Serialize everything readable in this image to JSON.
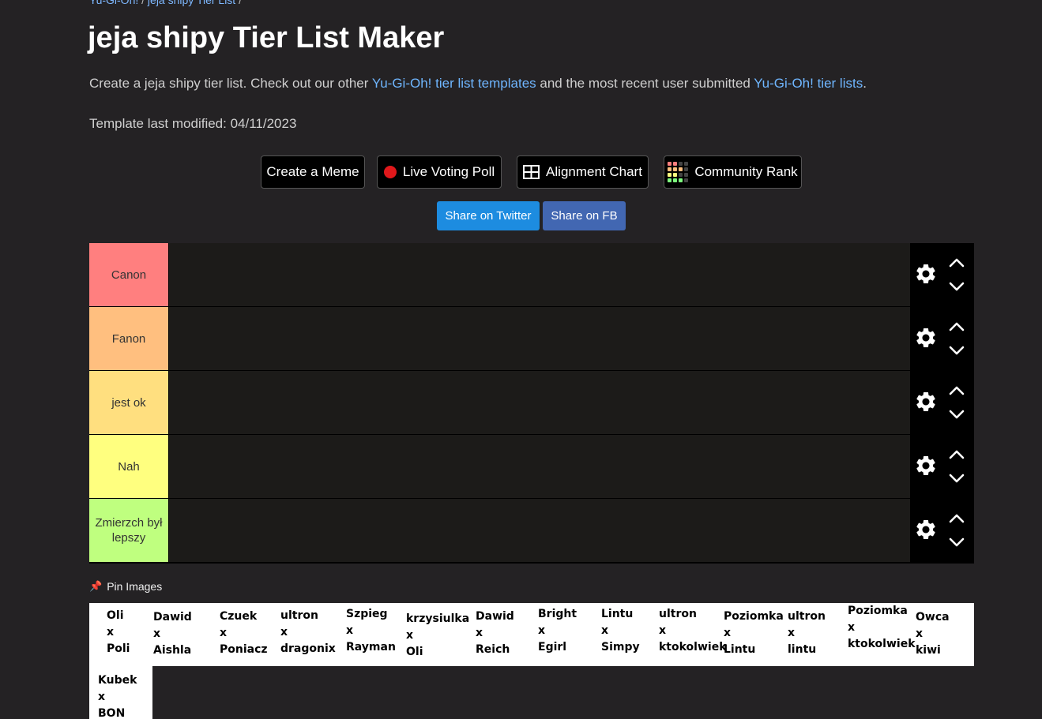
{
  "breadcrumb": {
    "item1": "Yu-Gi-Oh!",
    "item2": "jeja shipy Tier List",
    "sep": "/"
  },
  "title": "jeja shipy Tier List Maker",
  "description": {
    "part1": "Create a jeja shipy tier list. Check out our other ",
    "link1": "Yu-Gi-Oh! tier list templates",
    "part2": " and the most recent user submitted ",
    "link2": "Yu-Gi-Oh! tier lists",
    "part3": "."
  },
  "modified": "Template last modified: 04/11/2023",
  "buttons": {
    "meme": "Create a Meme",
    "poll": "Live Voting Poll",
    "alignment": "Alignment Chart",
    "community": "Community Rank"
  },
  "share": {
    "twitter": "Share on Twitter",
    "fb": "Share on FB"
  },
  "tiers": [
    {
      "label": "Canon",
      "color": "#ff7f7f"
    },
    {
      "label": "Fanon",
      "color": "#ffbf7f"
    },
    {
      "label": "jest ok",
      "color": "#ffdf7f"
    },
    {
      "label": "Nah",
      "color": "#ffff7f"
    },
    {
      "label": "Zmierzch był lepszy",
      "color": "#bfff7f"
    }
  ],
  "pin_label": "Pin Images",
  "cards": [
    {
      "l1": "Oli",
      "l2": "x",
      "l3": "Poli"
    },
    {
      "l1": "Dawid",
      "l2": "x",
      "l3": "Aishla"
    },
    {
      "l1": "Czuek",
      "l2": "x",
      "l3": "Poniacz"
    },
    {
      "l1": "ultron",
      "l2": "x",
      "l3": "dragonix"
    },
    {
      "l1": "Szpieg",
      "l2": "x",
      "l3": "Rayman"
    },
    {
      "l1": "krzysiulka",
      "l2": "x",
      "l3": "Oli"
    },
    {
      "l1": "Dawid",
      "l2": "x",
      "l3": "Reich"
    },
    {
      "l1": "Bright",
      "l2": "x",
      "l3": "Egirl"
    },
    {
      "l1": "Lintu",
      "l2": "x",
      "l3": "Simpy"
    },
    {
      "l1": "ultron",
      "l2": "x",
      "l3": "ktokolwiek"
    },
    {
      "l1": "Poziomka",
      "l2": "x",
      "l3": "Lintu"
    },
    {
      "l1": "ultron",
      "l2": "x",
      "l3": "lintu"
    },
    {
      "l1": "Poziomka",
      "l2": "x",
      "l3": "ktokolwiek"
    },
    {
      "l1": "Owca",
      "l2": "x",
      "l3": "kiwi"
    },
    {
      "l1": "Kubek",
      "l2": "x",
      "l3": "BON"
    }
  ]
}
